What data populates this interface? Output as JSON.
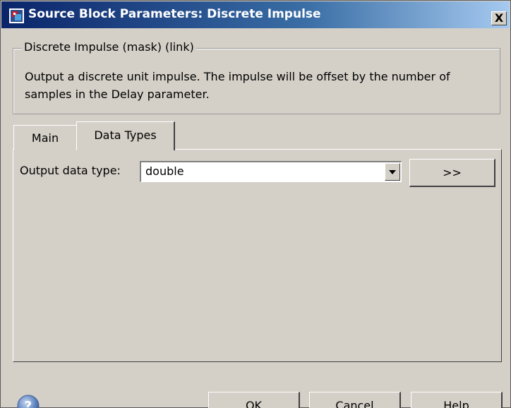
{
  "window": {
    "title": "Source Block Parameters: Discrete Impulse",
    "close_label": "X"
  },
  "description": {
    "legend": "Discrete Impulse  (mask) (link)",
    "text": "Output a discrete unit impulse.  The impulse will be offset by the number of samples in the Delay parameter."
  },
  "tabs": [
    {
      "label": "Main",
      "active": false
    },
    {
      "label": "Data Types",
      "active": true
    }
  ],
  "data_types": {
    "output_label": "Output data type:",
    "output_value": "double",
    "expand_label": ">>"
  },
  "footer": {
    "ok_label": "OK",
    "cancel_label": "Cancel",
    "help_label": "Help"
  },
  "icons": {
    "window": "simulink-block-icon",
    "help": "help-icon"
  },
  "colors": {
    "titlebar_start": "#0a246a",
    "titlebar_end": "#a6caf0",
    "dialog_bg": "#d4d0c8",
    "help_icon": "#6b8ec6"
  }
}
